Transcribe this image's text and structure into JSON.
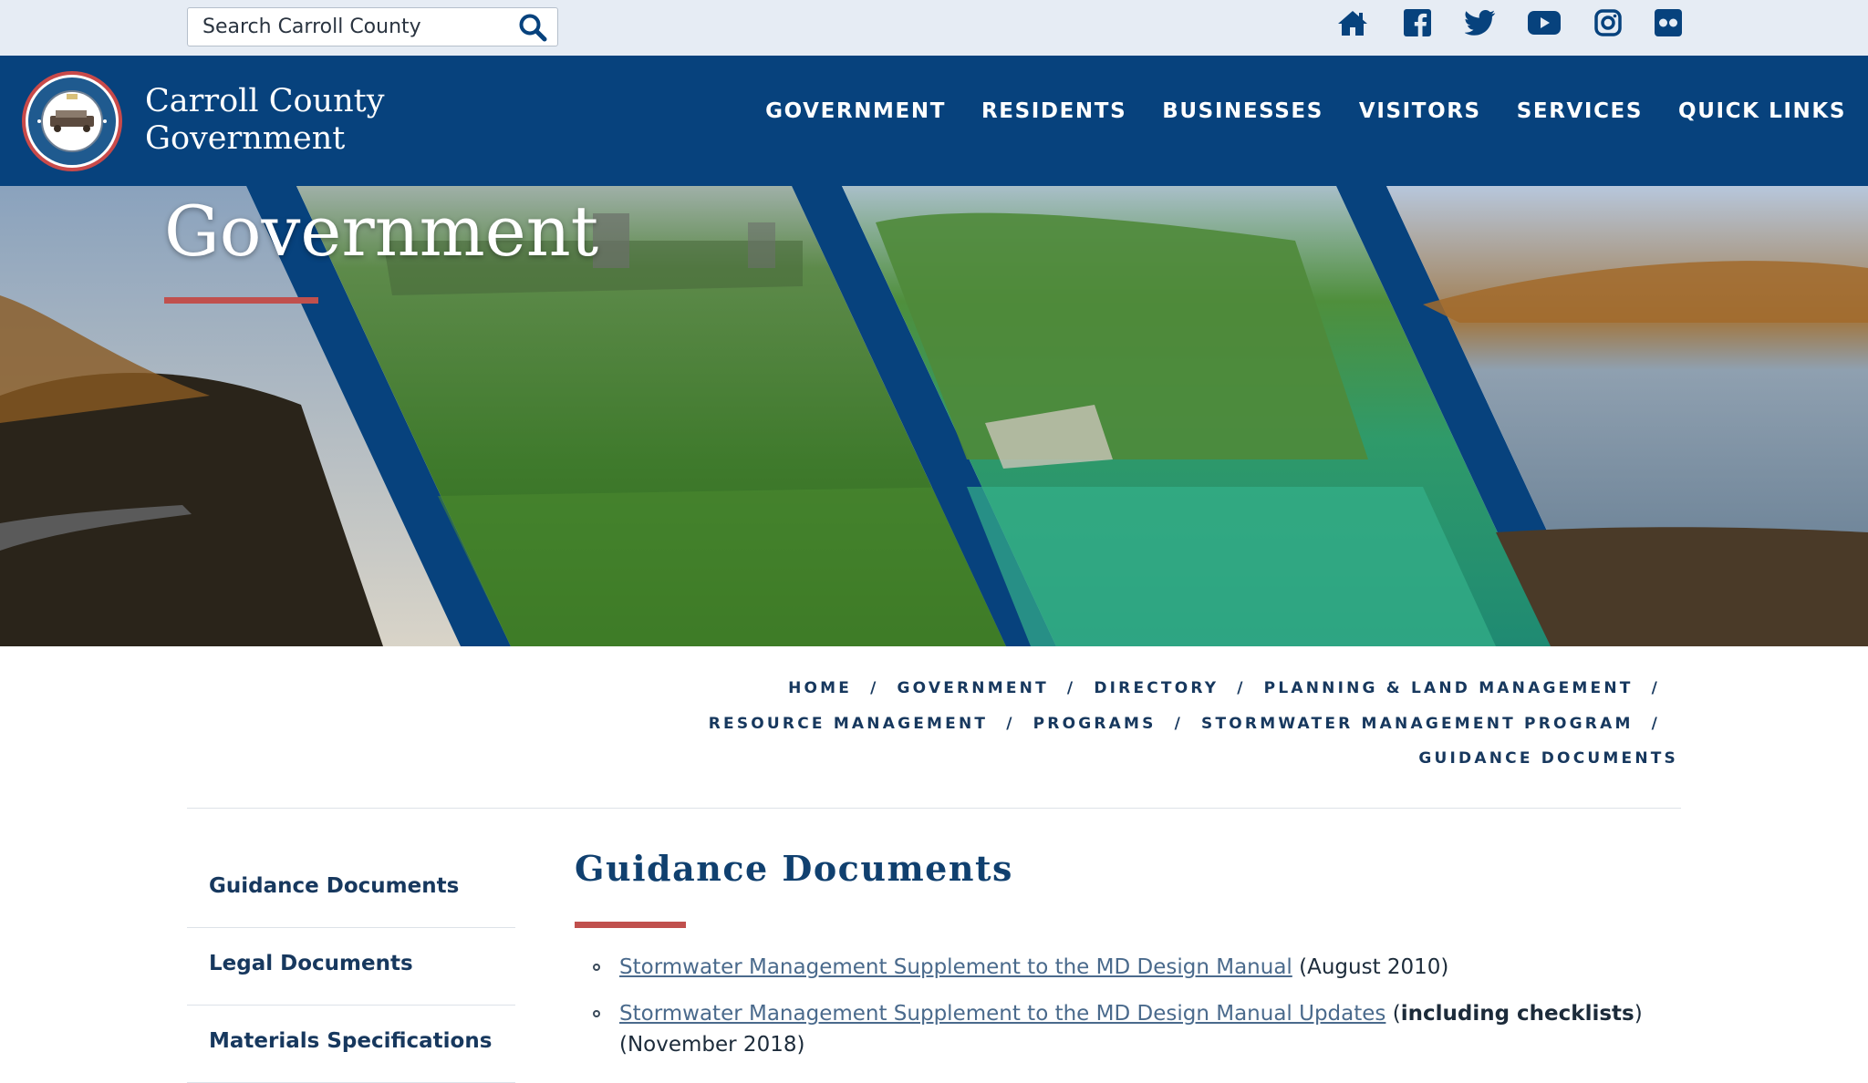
{
  "search": {
    "placeholder": "Search Carroll County"
  },
  "social": [
    "home-icon",
    "facebook-icon",
    "twitter-icon",
    "youtube-icon",
    "instagram-icon",
    "flickr-icon"
  ],
  "brand": {
    "line1": "Carroll County",
    "line2": "Government"
  },
  "nav": [
    "GOVERNMENT",
    "RESIDENTS",
    "BUSINESSES",
    "VISITORS",
    "SERVICES",
    "QUICK LINKS"
  ],
  "hero": {
    "title": "Government"
  },
  "breadcrumb": {
    "items": [
      "HOME",
      "GOVERNMENT",
      "DIRECTORY",
      "PLANNING & LAND MANAGEMENT",
      "RESOURCE MANAGEMENT",
      "PROGRAMS",
      "STORMWATER MANAGEMENT PROGRAM",
      "GUIDANCE DOCUMENTS"
    ],
    "separator": "/"
  },
  "sidebar": {
    "items": [
      {
        "label": "Guidance Documents"
      },
      {
        "label": "Legal Documents"
      },
      {
        "label": "Materials Specifications"
      }
    ]
  },
  "main": {
    "title": "Guidance Documents",
    "docs": [
      {
        "link": "Stormwater Management Supplement to the MD Design Manual",
        "note": " (August 2010)"
      },
      {
        "link": "Stormwater Management Supplement to the MD Design Manual Updates",
        "note_pre": " (",
        "note_bold": "including checklists",
        "note_post": ") (November 2018)"
      }
    ]
  },
  "colors": {
    "navy": "#07427d",
    "accent_red": "#c0504d",
    "utility_bg": "#e6ecf4",
    "link": "#4a6a8c"
  }
}
